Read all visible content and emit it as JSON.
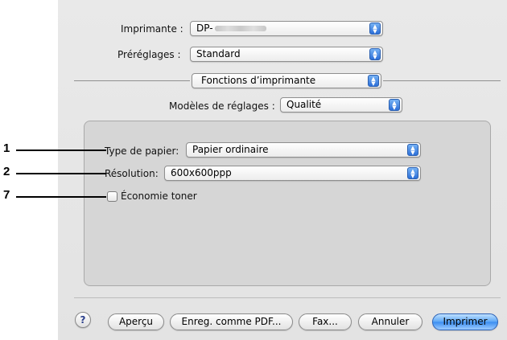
{
  "printer": {
    "label": "Imprimante :",
    "value_prefix": "DP-"
  },
  "presets": {
    "label": "Préréglages :",
    "value": "Standard"
  },
  "panel_menu": {
    "value": "Fonctions d’imprimante"
  },
  "feature_sets": {
    "label": "Modèles de réglages :",
    "value": "Qualité"
  },
  "paper_type": {
    "label": "Type de papier:",
    "value": "Papier ordinaire"
  },
  "resolution": {
    "label": "Résolution:",
    "value": "600x600ppp"
  },
  "toner_save": {
    "label": "Économie toner",
    "checked": false
  },
  "callouts": [
    "1",
    "2",
    "7"
  ],
  "buttons": {
    "help": "?",
    "preview": "Aperçu",
    "save_pdf": "Enreg. comme PDF...",
    "fax": "Fax...",
    "cancel": "Annuler",
    "print": "Imprimer"
  },
  "colors": {
    "accent": "#3a8df0",
    "dialog_bg": "#e6e6e6",
    "group_bg": "#d6d6d6"
  }
}
